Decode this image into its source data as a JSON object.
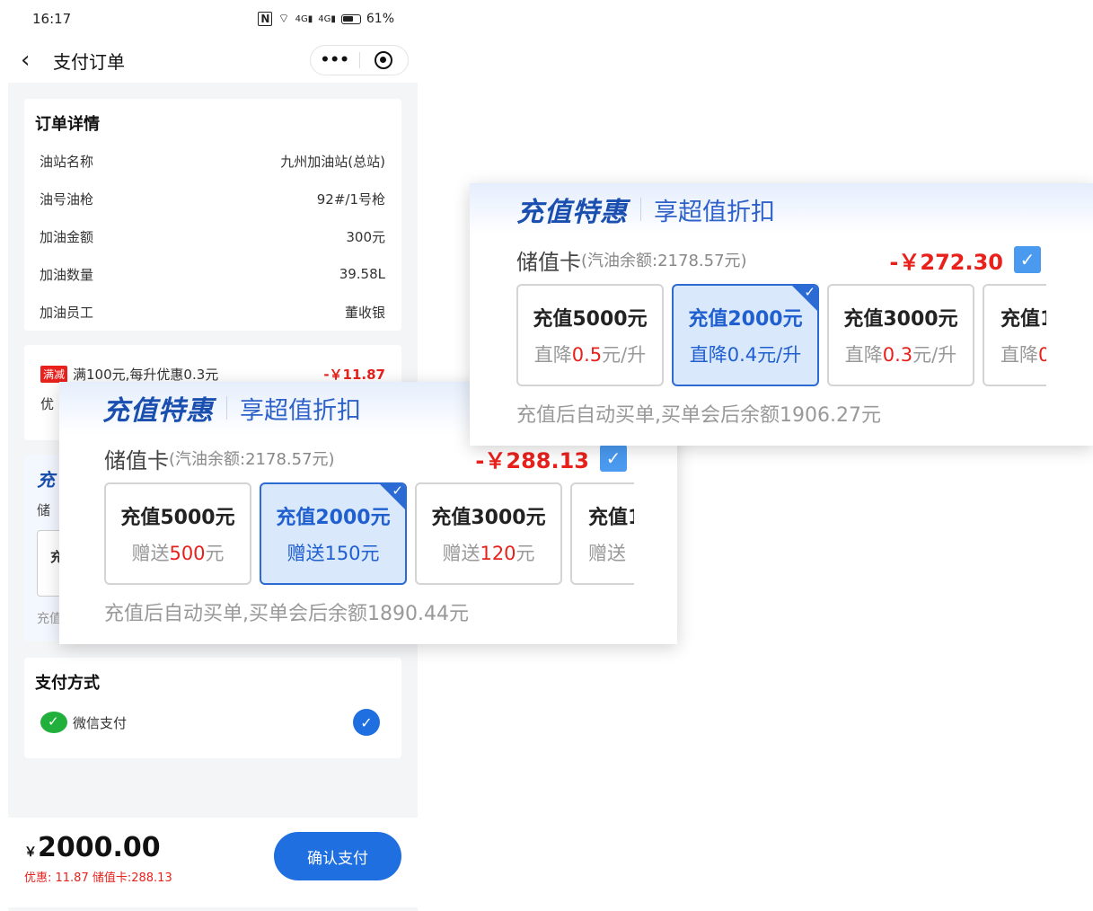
{
  "status": {
    "time": "16:17",
    "battery": "61%",
    "signal_a": "4G",
    "signal_b": "4G"
  },
  "nav": {
    "title": "支付订单",
    "more_label": "•••"
  },
  "order": {
    "title": "订单详情",
    "rows": [
      {
        "label": "油站名称",
        "value": "九州加油站(总站)"
      },
      {
        "label": "油号油枪",
        "value": "92#/1号枪"
      },
      {
        "label": "加油金额",
        "value": "300元"
      },
      {
        "label": "加油数量",
        "value": "39.58L"
      },
      {
        "label": "加油员工",
        "value": "董收银"
      }
    ]
  },
  "discount": {
    "badge": "满减",
    "text": "满100元,每升优惠0.3元",
    "amount": "-￥11.87",
    "row2_label": "优"
  },
  "hidden_card": {
    "brand_partial": "充",
    "label_partial": "储",
    "opt_partial": "充",
    "foot_partial": "充值"
  },
  "payment": {
    "title": "支付方式",
    "method": "微信支付"
  },
  "bottom": {
    "yen": "￥",
    "total": "2000.00",
    "sub": "优惠: 11.87  储值卡:288.13",
    "confirm": "确认支付"
  },
  "panel_a": {
    "brand": "充值特惠",
    "slogan": "享超值折扣",
    "store_label": "储值卡",
    "store_balance": "(汽油余额:2178.57元)",
    "amount": "-￥288.13",
    "options": [
      {
        "title": "充值5000元",
        "pre": "赠送",
        "hl": "500",
        "post": "元",
        "selected": false
      },
      {
        "title": "充值2000元",
        "pre": "赠送",
        "hl": "150",
        "post": "元",
        "selected": true
      },
      {
        "title": "充值3000元",
        "pre": "赠送",
        "hl": "120",
        "post": "元",
        "selected": false
      },
      {
        "title": "充值1",
        "pre": "赠送",
        "hl": "",
        "post": "",
        "selected": false
      }
    ],
    "footer": "充值后自动买单,买单会后余额1890.44元"
  },
  "panel_b": {
    "brand": "充值特惠",
    "slogan": "享超值折扣",
    "store_label": "储值卡",
    "store_balance": "(汽油余额:2178.57元)",
    "amount": "-￥272.30",
    "options": [
      {
        "title": "充值5000元",
        "pre": "直降",
        "hl": "0.5",
        "post": "元/升",
        "selected": false
      },
      {
        "title": "充值2000元",
        "pre": "直降",
        "hl": "0.4",
        "post": "元/升",
        "selected": true
      },
      {
        "title": "充值3000元",
        "pre": "直降",
        "hl": "0.3",
        "post": "元/升",
        "selected": false
      },
      {
        "title": "充值1",
        "pre": "直降",
        "hl": "0",
        "post": "",
        "selected": false
      }
    ],
    "footer": "充值后自动买单,买单会后余额1906.27元"
  }
}
